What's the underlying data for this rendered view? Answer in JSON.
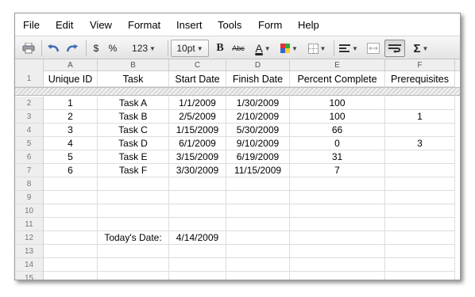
{
  "menu": [
    "File",
    "Edit",
    "View",
    "Format",
    "Insert",
    "Tools",
    "Form",
    "Help"
  ],
  "toolbar": {
    "currency": "$",
    "percent": "%",
    "number_format": "123",
    "font_size": "10pt",
    "bold": "B",
    "strike": "Abc",
    "text_color": "A",
    "sum": "Σ"
  },
  "columns": [
    "A",
    "B",
    "C",
    "D",
    "E",
    "F"
  ],
  "header_row": {
    "row_num": "1",
    "cells": [
      "Unique ID",
      "Task",
      "Start Date",
      "Finish Date",
      "Percent Complete",
      "Prerequisites"
    ]
  },
  "rows": [
    {
      "num": "2",
      "cells": [
        "1",
        "Task A",
        "1/1/2009",
        "1/30/2009",
        "100",
        ""
      ]
    },
    {
      "num": "3",
      "cells": [
        "2",
        "Task B",
        "2/5/2009",
        "2/10/2009",
        "100",
        "1"
      ]
    },
    {
      "num": "4",
      "cells": [
        "3",
        "Task C",
        "1/15/2009",
        "5/30/2009",
        "66",
        ""
      ]
    },
    {
      "num": "5",
      "cells": [
        "4",
        "Task D",
        "6/1/2009",
        "9/10/2009",
        "0",
        "3"
      ]
    },
    {
      "num": "6",
      "cells": [
        "5",
        "Task E",
        "3/15/2009",
        "6/19/2009",
        "31",
        ""
      ]
    },
    {
      "num": "7",
      "cells": [
        "6",
        "Task F",
        "3/30/2009",
        "11/15/2009",
        "7",
        ""
      ]
    },
    {
      "num": "8",
      "cells": [
        "",
        "",
        "",
        "",
        "",
        ""
      ]
    },
    {
      "num": "9",
      "cells": [
        "",
        "",
        "",
        "",
        "",
        ""
      ]
    },
    {
      "num": "10",
      "cells": [
        "",
        "",
        "",
        "",
        "",
        ""
      ]
    },
    {
      "num": "11",
      "cells": [
        "",
        "",
        "",
        "",
        "",
        ""
      ]
    },
    {
      "num": "12",
      "cells": [
        "",
        "Today's Date:",
        "4/14/2009",
        "",
        "",
        ""
      ]
    },
    {
      "num": "13",
      "cells": [
        "",
        "",
        "",
        "",
        "",
        ""
      ]
    },
    {
      "num": "14",
      "cells": [
        "",
        "",
        "",
        "",
        "",
        ""
      ]
    },
    {
      "num": "15",
      "cells": [
        "",
        "",
        "",
        "",
        "",
        ""
      ]
    }
  ]
}
